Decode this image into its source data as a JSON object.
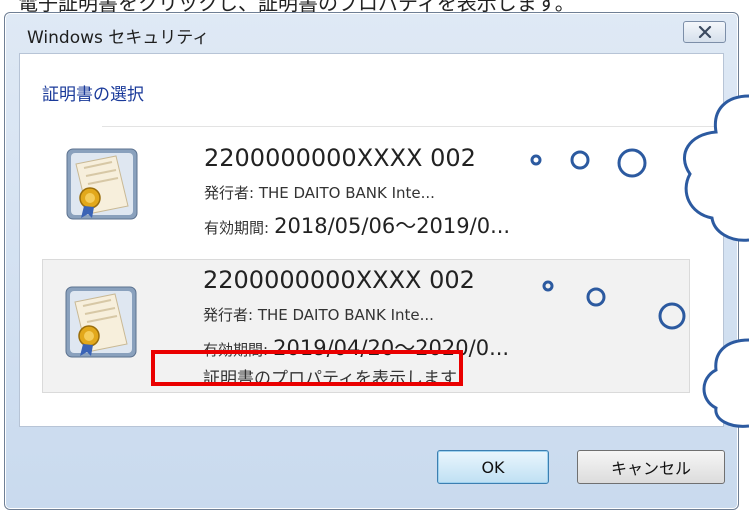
{
  "top_caption": "電子証明書をクリックし、証明書のプロパティを表示します。",
  "window": {
    "title": "Windows セキュリティ",
    "close_icon": "close-icon"
  },
  "content": {
    "section_header": "証明書の選択",
    "certificates": [
      {
        "name": "2200000000XXXX 002",
        "issuer": "発行者: THE DAITO BANK Inte...",
        "validity_label": "有効期間:",
        "validity_value": "2018/05/06〜2019/0..."
      },
      {
        "name": "2200000000XXXX  002",
        "issuer": "発行者: THE DAITO BANK Inte...",
        "validity_label": "有効期間:",
        "validity_value": "2019/04/20〜2020/0...",
        "link": "証明書のプロパティを表示します"
      }
    ]
  },
  "buttons": {
    "ok": "OK",
    "cancel": "キャンセル"
  },
  "colors": {
    "highlight": "#ea0000",
    "header_text": "#1a3a9a"
  }
}
